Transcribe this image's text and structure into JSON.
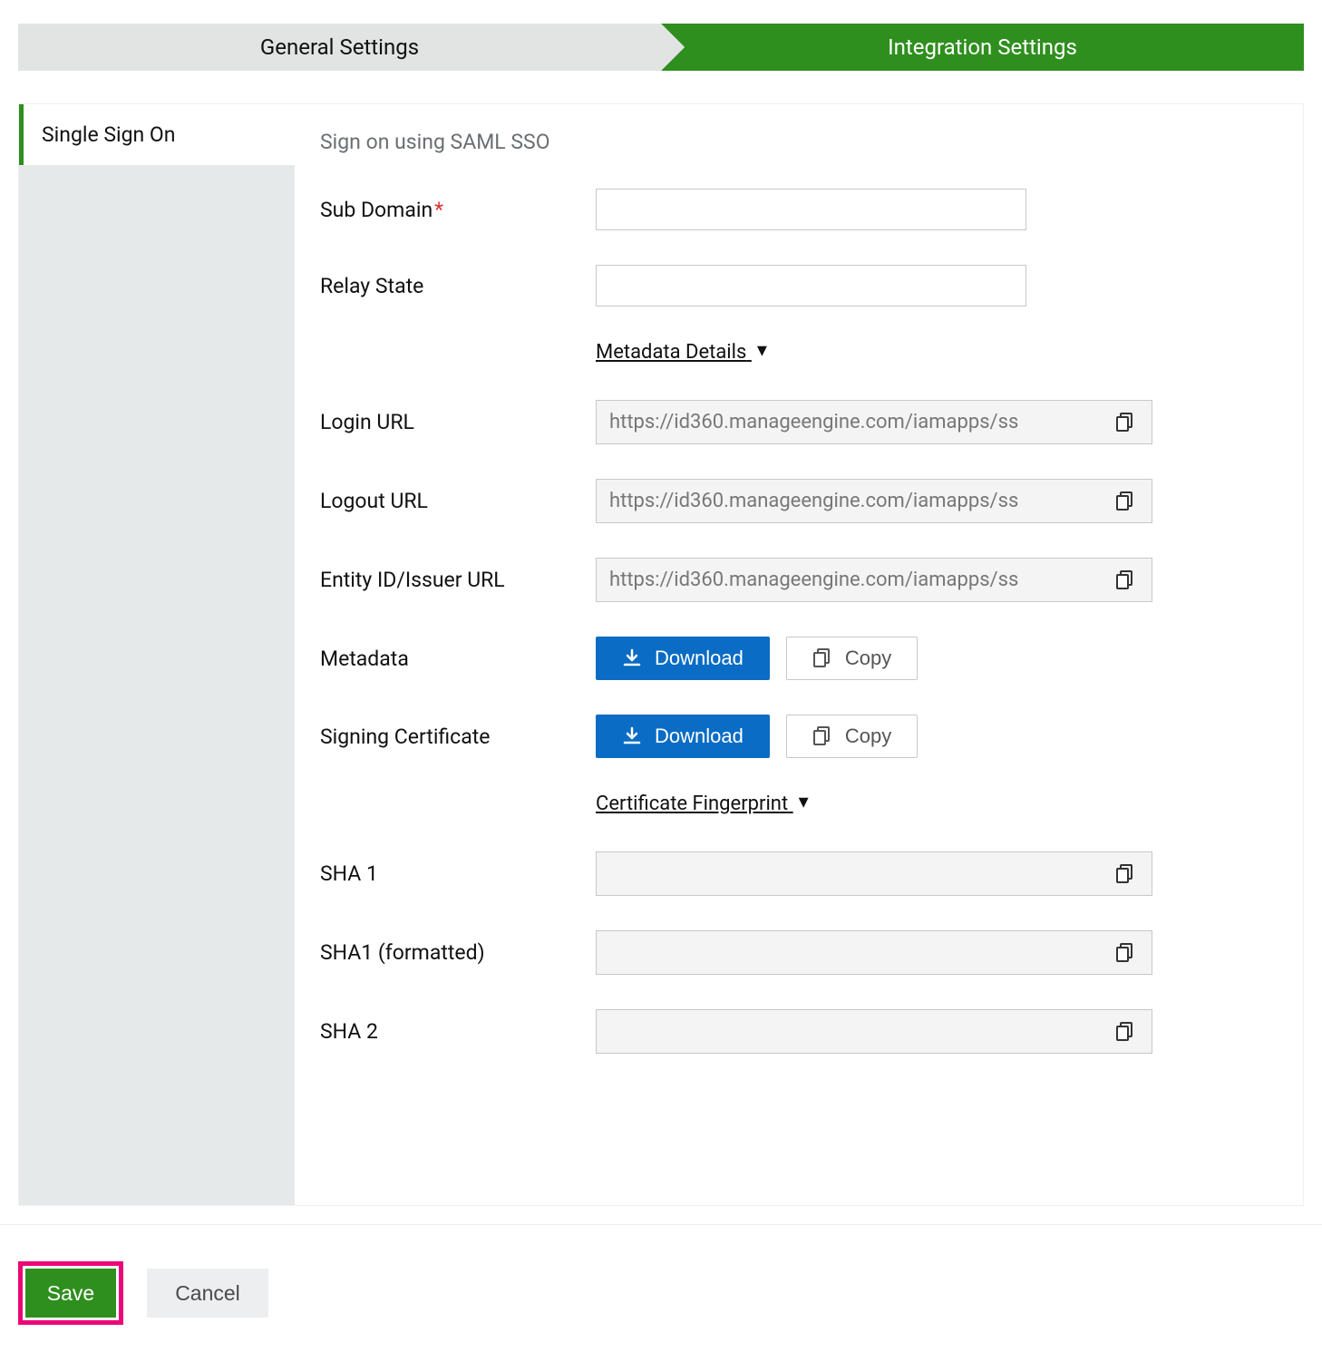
{
  "stepper": {
    "step1": "General Settings",
    "step2": "Integration Settings"
  },
  "sidebar": {
    "item": "Single Sign On"
  },
  "section_title": "Sign on using SAML SSO",
  "labels": {
    "sub_domain": "Sub Domain",
    "relay_state": "Relay State",
    "metadata_details": "Metadata Details",
    "login_url": "Login URL",
    "logout_url": "Logout URL",
    "entity_id": "Entity ID/Issuer URL",
    "metadata": "Metadata",
    "signing_cert": "Signing Certificate",
    "cert_fingerprint": "Certificate Fingerprint",
    "sha1": "SHA 1",
    "sha1_fmt": "SHA1 (formatted)",
    "sha2": "SHA 2"
  },
  "values": {
    "sub_domain": "",
    "relay_state": "",
    "login_url": "https://id360.manageengine.com/iamapps/ss",
    "logout_url": "https://id360.manageengine.com/iamapps/ss",
    "entity_id": "https://id360.manageengine.com/iamapps/ss",
    "sha1": "",
    "sha1_fmt": "",
    "sha2": ""
  },
  "buttons": {
    "download": "Download",
    "copy": "Copy",
    "save": "Save",
    "cancel": "Cancel"
  }
}
